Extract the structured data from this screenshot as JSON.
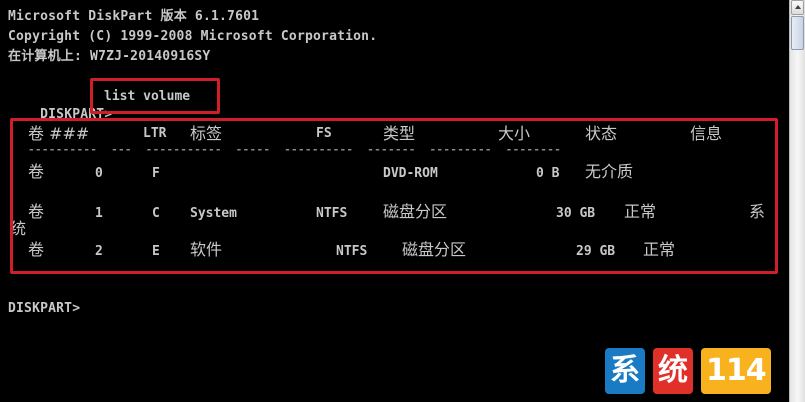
{
  "console": {
    "line1": "Microsoft DiskPart 版本 6.1.7601",
    "line2": "Copyright (C) 1999-2008 Microsoft Corporation.",
    "line3": "在计算机上: W7ZJ-20140916SY",
    "prompt1": "DISKPART>",
    "command": "list volume",
    "prompt2": "DISKPART>"
  },
  "table": {
    "headers": [
      "卷 ###",
      "LTR",
      "标签",
      "FS",
      "类型",
      "大小",
      "状态",
      "信息"
    ],
    "separator": "----------  ---  -----------  -----  ----------  -------  ---------  --------",
    "rows": [
      {
        "vol": "卷",
        "num": "0",
        "ltr": "F",
        "label": "",
        "fs": "",
        "type": "DVD-ROM",
        "size": "0 B",
        "status": "无介质",
        "info": ""
      },
      {
        "vol": "卷",
        "num": "1",
        "ltr": "C",
        "label": "System",
        "fs": "NTFS",
        "type": "磁盘分区",
        "size": "30 GB",
        "status": "正常",
        "info": "系统"
      },
      {
        "vol": "卷",
        "num": "2",
        "ltr": "E",
        "label": "软件",
        "fs": "NTFS",
        "type": "磁盘分区",
        "size": "29 GB",
        "status": "正常",
        "info": ""
      }
    ]
  },
  "info_wrap": {
    "part1": "系",
    "part2": "统"
  },
  "watermark": {
    "word1": "系",
    "word2": "统",
    "number": "114"
  },
  "colors": {
    "highlight": "#d01e28",
    "text": "#c8c8c8",
    "background": "#000000"
  }
}
